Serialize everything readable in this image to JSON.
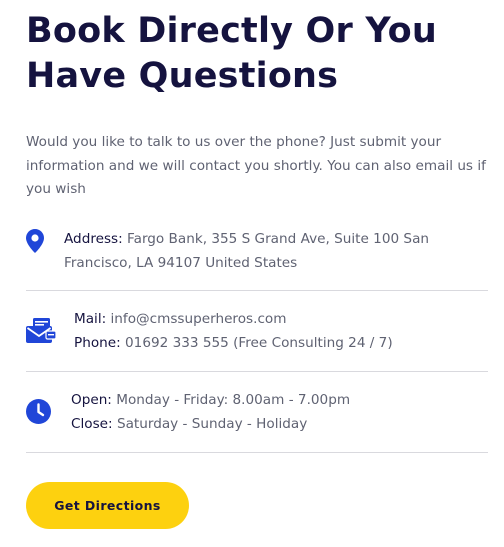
{
  "heading": {
    "line1": "Book Directly Or You",
    "line2": "Have Questions"
  },
  "intro": "Would you like to talk to us over the phone? Just submit your information and we will contact you shortly. You can also email us if you wish",
  "address": {
    "label": "Address:",
    "value": " Fargo Bank, 355 S Grand Ave, Suite 100 San Francisco, LA 94107 United States",
    "icon": "map-pin-icon"
  },
  "contact": {
    "icon": "mail-card-icon",
    "mail_label": "Mail:",
    "mail_value": " info@cmssuperheros.com",
    "phone_label": "Phone:",
    "phone_value": " 01692 333 555 (Free Consulting 24 / 7)"
  },
  "hours": {
    "icon": "clock-icon",
    "open_label": "Open:",
    "open_value": " Monday - Friday: 8.00am - 7.00pm",
    "close_label": "Close:",
    "close_value": " Saturday - Sunday - Holiday"
  },
  "button": {
    "label": "Get Directions"
  },
  "colors": {
    "heading": "#15133f",
    "accent_blue": "#2046d8",
    "button_yellow": "#fdd10f",
    "divider": "#d9d9de"
  }
}
